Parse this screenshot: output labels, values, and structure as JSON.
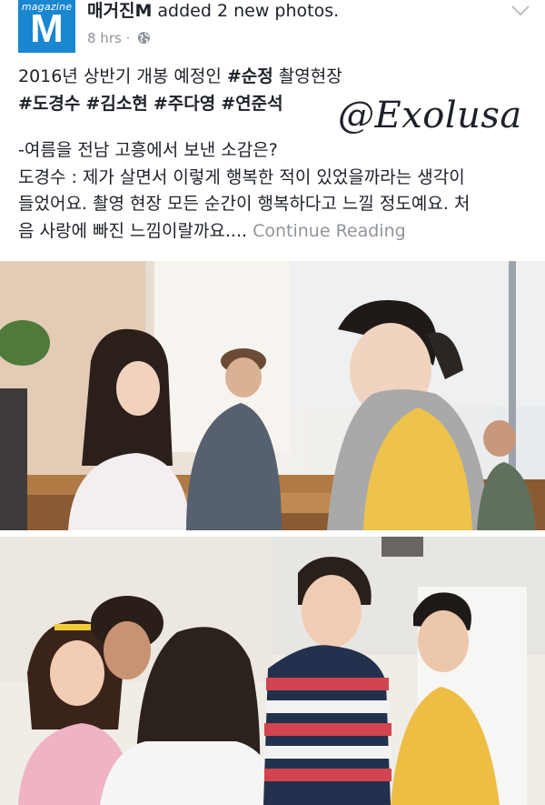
{
  "page": {
    "logo_small": "magazine",
    "logo_big": "M",
    "name": "매거진M",
    "action": "added 2 new photos.",
    "time": "8 hrs",
    "separator": "·"
  },
  "post": {
    "line1_prefix": "2016년 상반기 개봉 예정인 ",
    "line1_tag": "#순정",
    "line1_suffix": " 촬영현장",
    "tags": [
      "#도경수",
      "#김소현",
      "#주다영",
      "#연준석"
    ],
    "question": "-여름을 전남 고흥에서 보낸 소감은?",
    "answer_line1": "도경수 : 제가 살면서 이렇게 행복한 적이 있었을까라는 생각이",
    "answer_line2": "들었어요. 촬영 현장 모든 순간이 행복하다고 느낄 정도예요. 처",
    "answer_line3": "음 사랑에 빠진 느낌이랄까요....",
    "continue_reading": "Continue Reading"
  },
  "watermark": "@Exolusa",
  "icons": {
    "privacy": "globe-icon",
    "menu": "chevron-down-icon"
  },
  "colors": {
    "brand": "#1a86d0",
    "meta": "#90949c",
    "text": "#1d2129"
  }
}
